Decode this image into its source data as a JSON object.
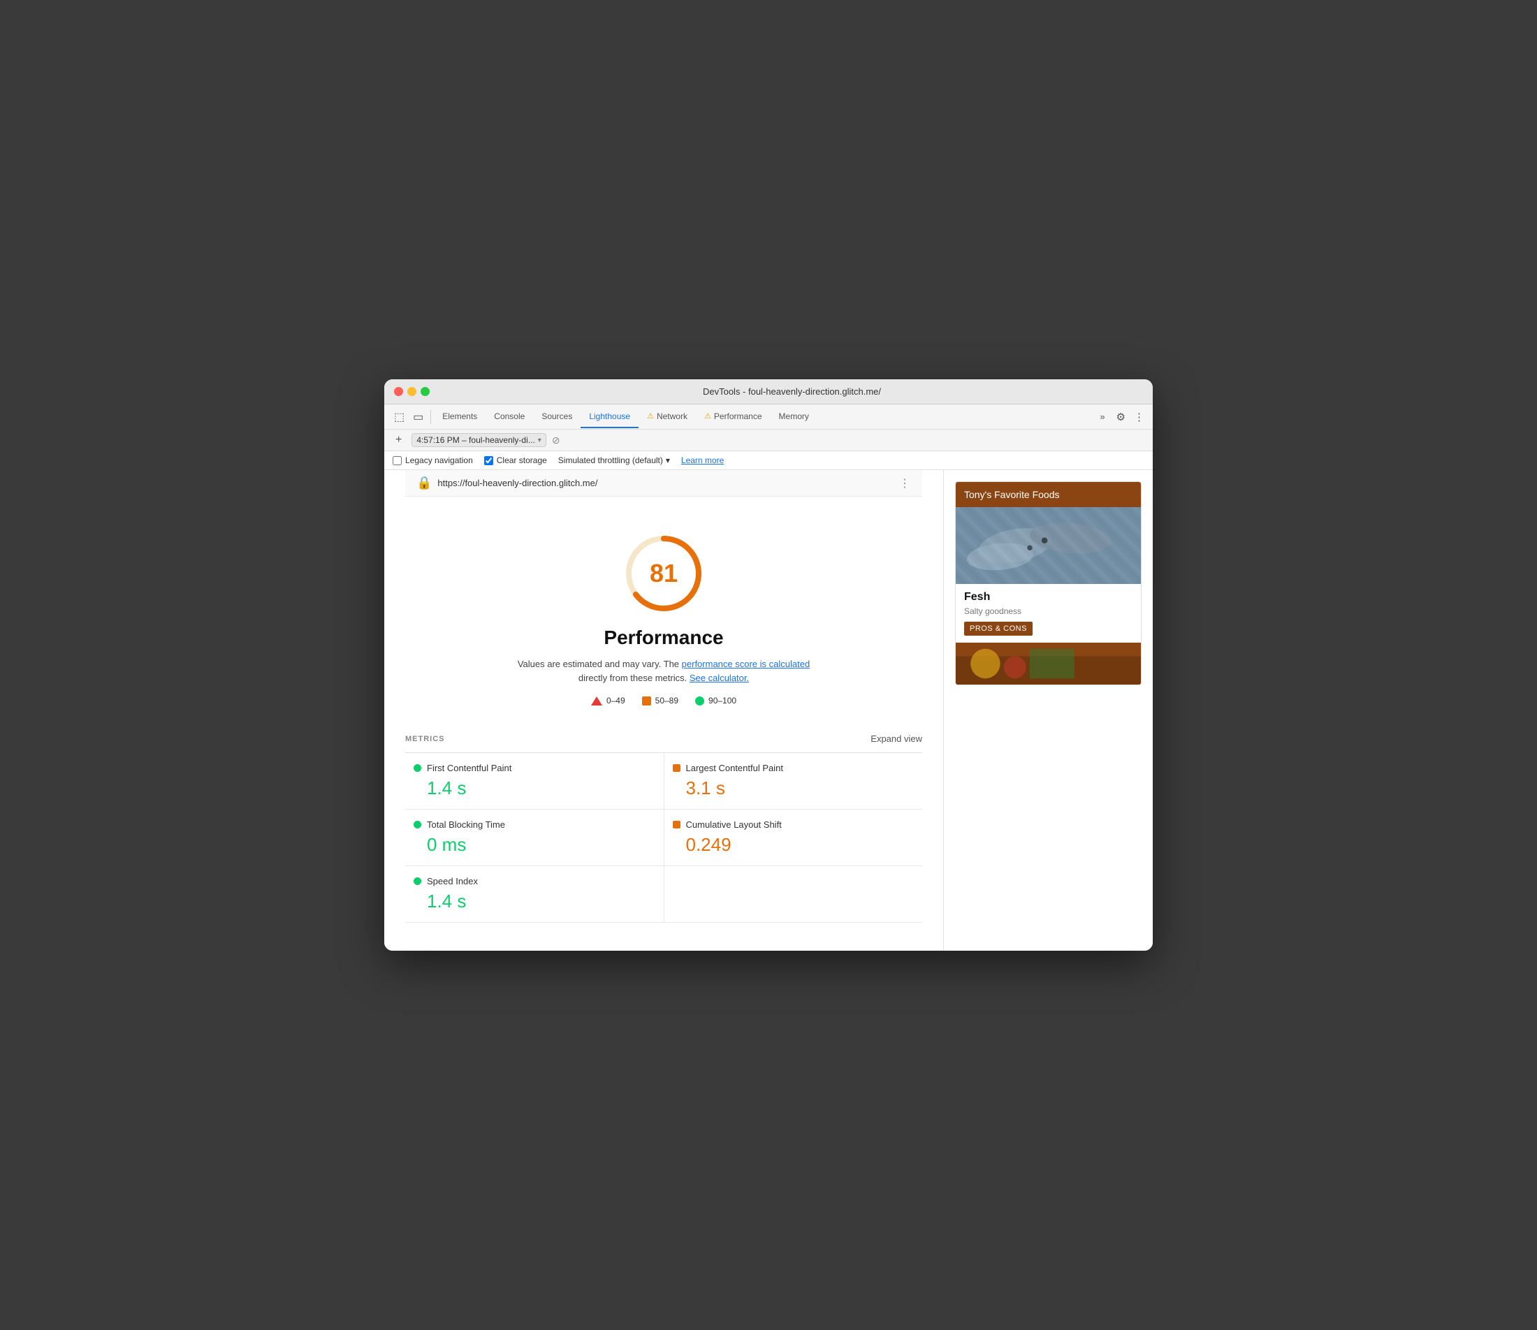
{
  "window": {
    "title": "DevTools - foul-heavenly-direction.glitch.me/"
  },
  "tabs": [
    {
      "id": "elements",
      "label": "Elements",
      "active": false,
      "warning": false
    },
    {
      "id": "console",
      "label": "Console",
      "active": false,
      "warning": false
    },
    {
      "id": "sources",
      "label": "Sources",
      "active": false,
      "warning": false
    },
    {
      "id": "lighthouse",
      "label": "Lighthouse",
      "active": true,
      "warning": false
    },
    {
      "id": "network",
      "label": "Network",
      "active": false,
      "warning": true
    },
    {
      "id": "performance",
      "label": "Performance",
      "active": false,
      "warning": true
    },
    {
      "id": "memory",
      "label": "Memory",
      "active": false,
      "warning": false
    }
  ],
  "session": {
    "label": "4:57:16 PM – foul-heavenly-di..."
  },
  "options": {
    "legacy_navigation": {
      "label": "Legacy navigation",
      "checked": false
    },
    "clear_storage": {
      "label": "Clear storage",
      "checked": true
    },
    "throttling": {
      "label": "Simulated throttling (default)"
    },
    "learn_more": "Learn more"
  },
  "url_bar": {
    "url": "https://foul-heavenly-direction.glitch.me/"
  },
  "score": {
    "value": 81,
    "title": "Performance",
    "desc_text": "Values are estimated and may vary. The ",
    "perf_score_link": "performance score is calculated",
    "desc_mid": " directly from these metrics. ",
    "calculator_link": "See calculator.",
    "ring_color": "#e8700a",
    "ring_bg": "#f5e6c8"
  },
  "legend": [
    {
      "id": "red",
      "range": "0–49"
    },
    {
      "id": "orange",
      "range": "50–89"
    },
    {
      "id": "green",
      "range": "90–100"
    }
  ],
  "metrics": {
    "header_label": "METRICS",
    "expand_label": "Expand view",
    "items": [
      {
        "name": "First Contentful Paint",
        "value": "1.4 s",
        "dot_color": "green",
        "value_color": "green"
      },
      {
        "name": "Largest Contentful Paint",
        "value": "3.1 s",
        "dot_color": "orange",
        "value_color": "orange"
      },
      {
        "name": "Total Blocking Time",
        "value": "0 ms",
        "dot_color": "green",
        "value_color": "green"
      },
      {
        "name": "Cumulative Layout Shift",
        "value": "0.249",
        "dot_color": "orange",
        "value_color": "orange"
      },
      {
        "name": "Speed Index",
        "value": "1.4 s",
        "dot_color": "green",
        "value_color": "green"
      }
    ]
  },
  "preview": {
    "header": "Tony's Favorite Foods",
    "item1": {
      "title": "Fesh",
      "subtitle": "Salty goodness",
      "btn": "PROS & CONS"
    }
  }
}
